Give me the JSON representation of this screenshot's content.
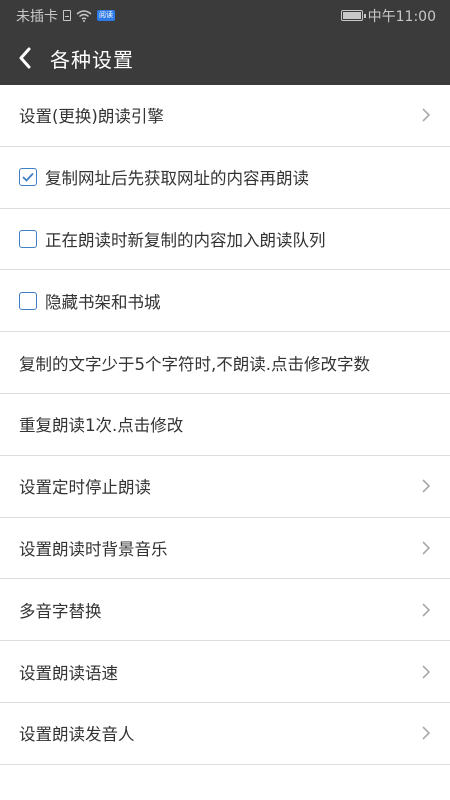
{
  "status_bar": {
    "carrier": "未插卡",
    "app_badge": "阅读",
    "time": "中午11:00"
  },
  "header": {
    "title": "各种设置"
  },
  "settings": [
    {
      "label": "设置(更换)朗读引擎",
      "type": "nav"
    },
    {
      "label": "复制网址后先获取网址的内容再朗读",
      "type": "checkbox",
      "checked": true
    },
    {
      "label": "正在朗读时新复制的内容加入朗读队列",
      "type": "checkbox",
      "checked": false
    },
    {
      "label": "隐藏书架和书城",
      "type": "checkbox",
      "checked": false
    },
    {
      "label": "复制的文字少于5个字符时,不朗读.点击修改字数",
      "type": "action"
    },
    {
      "label": "重复朗读1次.点击修改",
      "type": "action"
    },
    {
      "label": "设置定时停止朗读",
      "type": "nav"
    },
    {
      "label": "设置朗读时背景音乐",
      "type": "nav"
    },
    {
      "label": "多音字替换",
      "type": "nav"
    },
    {
      "label": "设置朗读语速",
      "type": "nav"
    },
    {
      "label": "设置朗读发音人",
      "type": "nav"
    }
  ],
  "colors": {
    "header_bg": "#3b3b3b",
    "checkbox_accent": "#3f7fc6",
    "divider": "#dedede"
  }
}
